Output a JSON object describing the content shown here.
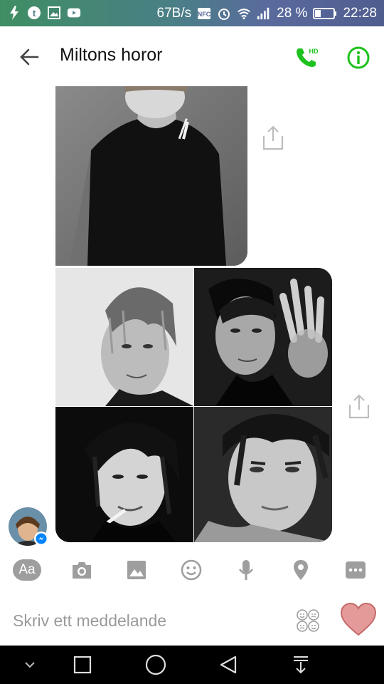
{
  "status_bar": {
    "network_speed": "67B/s",
    "battery_percent": "28 %",
    "time": "22:28",
    "icons": [
      "flash-icon",
      "tumblr-icon",
      "gallery-icon",
      "youtube-icon",
      "nfc-icon",
      "alarm-icon",
      "wifi-icon",
      "signal-icon",
      "battery-icon"
    ]
  },
  "header": {
    "title": "Miltons horor",
    "back_icon": "arrow-left-icon",
    "call_icon": "hd-phone-icon",
    "info_icon": "info-icon",
    "accent_color": "#1ec21e"
  },
  "messages": {
    "photos": [
      "photo-smoking-tshirt",
      "photo-messy-hair",
      "photo-hand-raised",
      "photo-cigarette-closeup",
      "photo-intense-stare"
    ],
    "share_icon": "share-icon"
  },
  "toolbar": {
    "aa_label": "Aa",
    "items": [
      "text-format-button",
      "camera-icon",
      "image-icon",
      "emoji-icon",
      "microphone-icon",
      "location-icon",
      "more-icon"
    ]
  },
  "composer": {
    "placeholder": "Skriv ett meddelande",
    "value": "",
    "like_icon": "heart-icon",
    "like_color": "#e59a9a"
  },
  "nav_bar": {
    "items": [
      "hide-keyboard-icon",
      "recents-icon",
      "home-icon",
      "back-triangle-icon",
      "notifications-pull-icon"
    ]
  }
}
